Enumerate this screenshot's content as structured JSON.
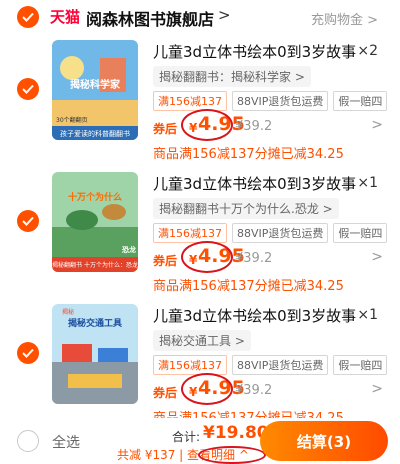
{
  "shop": {
    "platform": "天猫",
    "name": "阅森林图书旗舰店",
    "chevron": ">",
    "coupon": "充购物金 >"
  },
  "items": [
    {
      "title": "儿童3d立体书绘本0到3岁故事",
      "qty": "×2",
      "sku": "揭秘翻翻书：揭秘科学家 >",
      "tags": [
        "满156减137",
        "88VIP退货包运费",
        "假一赔四"
      ],
      "after_label": "券后",
      "currency": "¥",
      "price": "4.95",
      "orig_price": "¥39.2",
      "promo": "商品满156减137分摊已减34.25",
      "cover_title": "揭秘科学家",
      "cover_sub": "孩子爱读的科普翻翻书",
      "cover_badge": "30个翻翻页"
    },
    {
      "title": "儿童3d立体书绘本0到3岁故事",
      "qty": "×1",
      "sku": "揭秘翻翻书十万个为什么.恐龙 >",
      "tags": [
        "满156减137",
        "88VIP退货包运费",
        "假一赔四"
      ],
      "after_label": "券后",
      "currency": "¥",
      "price": "4.95",
      "orig_price": "¥39.2",
      "promo": "商品满156减137分摊已减34.25",
      "cover_title": "十万个为什么",
      "cover_sub": "揭秘翻翻书 十万个为什么：恐龙",
      "cover_badge": "恐龙"
    },
    {
      "title": "儿童3d立体书绘本0到3岁故事",
      "qty": "×1",
      "sku": "揭秘交通工具 >",
      "tags": [
        "满156减137",
        "88VIP退货包运费",
        "假一赔四"
      ],
      "after_label": "券后",
      "currency": "¥",
      "price": "4.95",
      "orig_price": "¥39.2",
      "promo": "商品满156减137分摊已减34.25",
      "cover_title": "揭秘交通工具",
      "cover_sub": "",
      "cover_badge": "揭秘"
    }
  ],
  "footer": {
    "select_all": "全选",
    "total_label": "合计:",
    "total": "¥19.80",
    "detail": "共减 ¥137 | 查看明细 ^",
    "checkout": "结算(3)"
  },
  "colors": {
    "accent": "#ff5000",
    "tmall": "#ff0036",
    "annotation": "#d8141c"
  }
}
